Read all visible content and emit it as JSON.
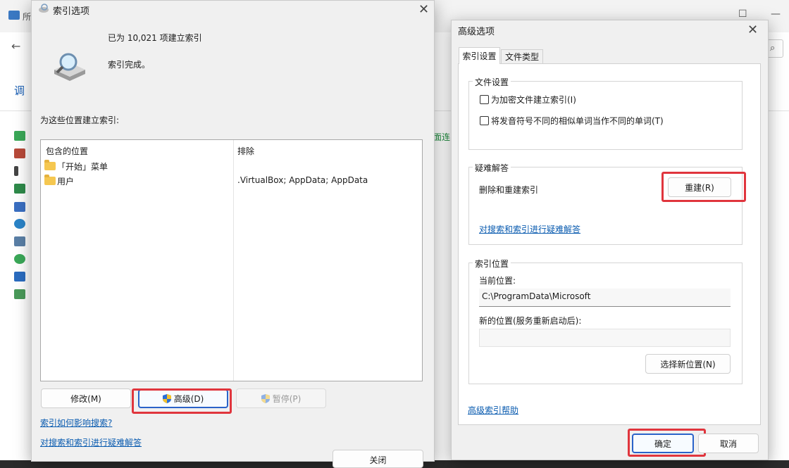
{
  "background": {
    "title_fragment": "所",
    "heading_fragment": "调",
    "link_fragment": "面连",
    "win_controls": {
      "minimize": "—",
      "maximize": "☐"
    }
  },
  "indexing_dialog": {
    "title": "索引选项",
    "close": "✕",
    "status_count": "已为 10,021 项建立索引",
    "status_text": "索引完成。",
    "locations_label": "为这些位置建立索引:",
    "columns": [
      "包含的位置",
      "排除"
    ],
    "rows": [
      {
        "location": "「开始」菜单",
        "exclude": ""
      },
      {
        "location": "用户",
        "exclude": ".VirtualBox; AppData; AppData"
      }
    ],
    "modify_button": "修改(M)",
    "advanced_button": "高级(D)",
    "pause_button": "暂停(P)",
    "link_affect": "索引如何影响搜索?",
    "link_troubleshoot": "对搜索和索引进行疑难解答",
    "close_button": "关闭"
  },
  "advanced_dialog": {
    "title": "高级选项",
    "close": "✕",
    "tabs": [
      "索引设置",
      "文件类型"
    ],
    "file_settings": {
      "title": "文件设置",
      "checkbox_encrypt": "为加密文件建立索引(I)",
      "checkbox_diacritics": "将发音符号不同的相似单词当作不同的单词(T)"
    },
    "troubleshoot": {
      "title": "疑难解答",
      "rebuild_label": "删除和重建索引",
      "rebuild_button": "重建(R)",
      "link": "对搜索和索引进行疑难解答"
    },
    "index_location": {
      "title": "索引位置",
      "current_label": "当前位置:",
      "current_value": "C:\\ProgramData\\Microsoft",
      "new_label": "新的位置(服务重新启动后):",
      "new_value": "",
      "select_button": "选择新位置(N)"
    },
    "help_link": "高级索引帮助",
    "ok_button": "确定",
    "cancel_button": "取消"
  },
  "colors": {
    "highlight": "#e0353d",
    "link": "#0b5cb0",
    "primary_border": "#2a63c9"
  }
}
